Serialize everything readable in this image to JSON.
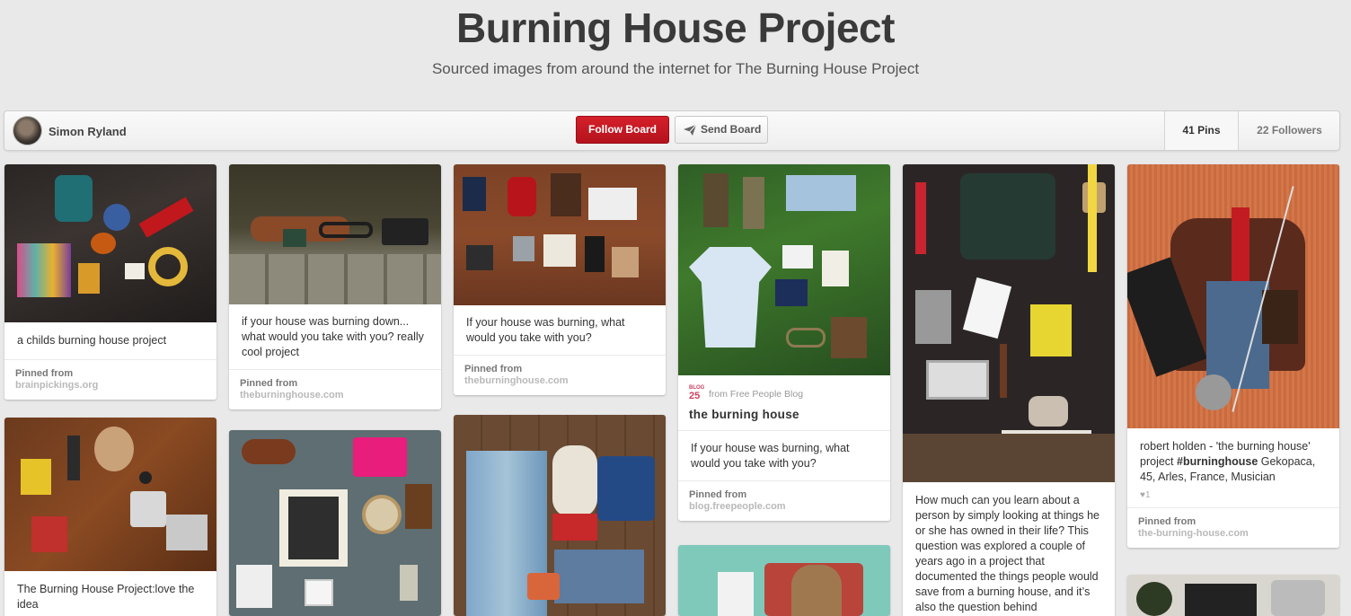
{
  "board": {
    "title": "Burning House Project",
    "description": "Sourced images from around the internet for The Burning House Project"
  },
  "header": {
    "owner_name": "Simon Ryland",
    "follow_label": "Follow Board",
    "send_label": "Send Board",
    "pins_label": "41 Pins",
    "followers_label": "22 Followers"
  },
  "pins": [
    {
      "desc": "a childs burning house project",
      "pinned_from": "Pinned from",
      "source": "brainpickings.org"
    },
    {
      "desc": "The Burning House Project:love the idea"
    },
    {
      "desc": "if your house was burning down... what would you take with you? really cool project",
      "pinned_from": "Pinned from",
      "source": "theburninghouse.com"
    },
    {
      "desc": ""
    },
    {
      "desc": "If your house was burning, what would you take with you?",
      "pinned_from": "Pinned from",
      "source": "theburninghouse.com"
    },
    {
      "desc": ""
    },
    {
      "blog_logo_top": "BLOG",
      "blog_logo_num": "25",
      "blog_from": "from Free People Blog",
      "blog_title": "the burning house",
      "desc": "If your house was burning, what would you take with you?",
      "pinned_from": "Pinned from",
      "source": "blog.freepeople.com"
    },
    {
      "desc": ""
    },
    {
      "desc": "How much can you learn about a person by simply looking at things he or she has owned in their life? This question was explored a couple of years ago in a project that documented the things people would save from a burning house, and it’s also the question behind"
    },
    {
      "desc_plain": "robert holden - 'the burning house' project ",
      "desc_hashtag": "#burninghouse",
      "desc_rest": " Gekopaca, 45, Arles, France, Musician",
      "likes": "1",
      "pinned_from": "Pinned from",
      "source": "the-burning-house.com"
    },
    {
      "desc": ""
    }
  ],
  "colors": {
    "follow_button": "#cb1f27",
    "background": "#e9e9e9"
  }
}
